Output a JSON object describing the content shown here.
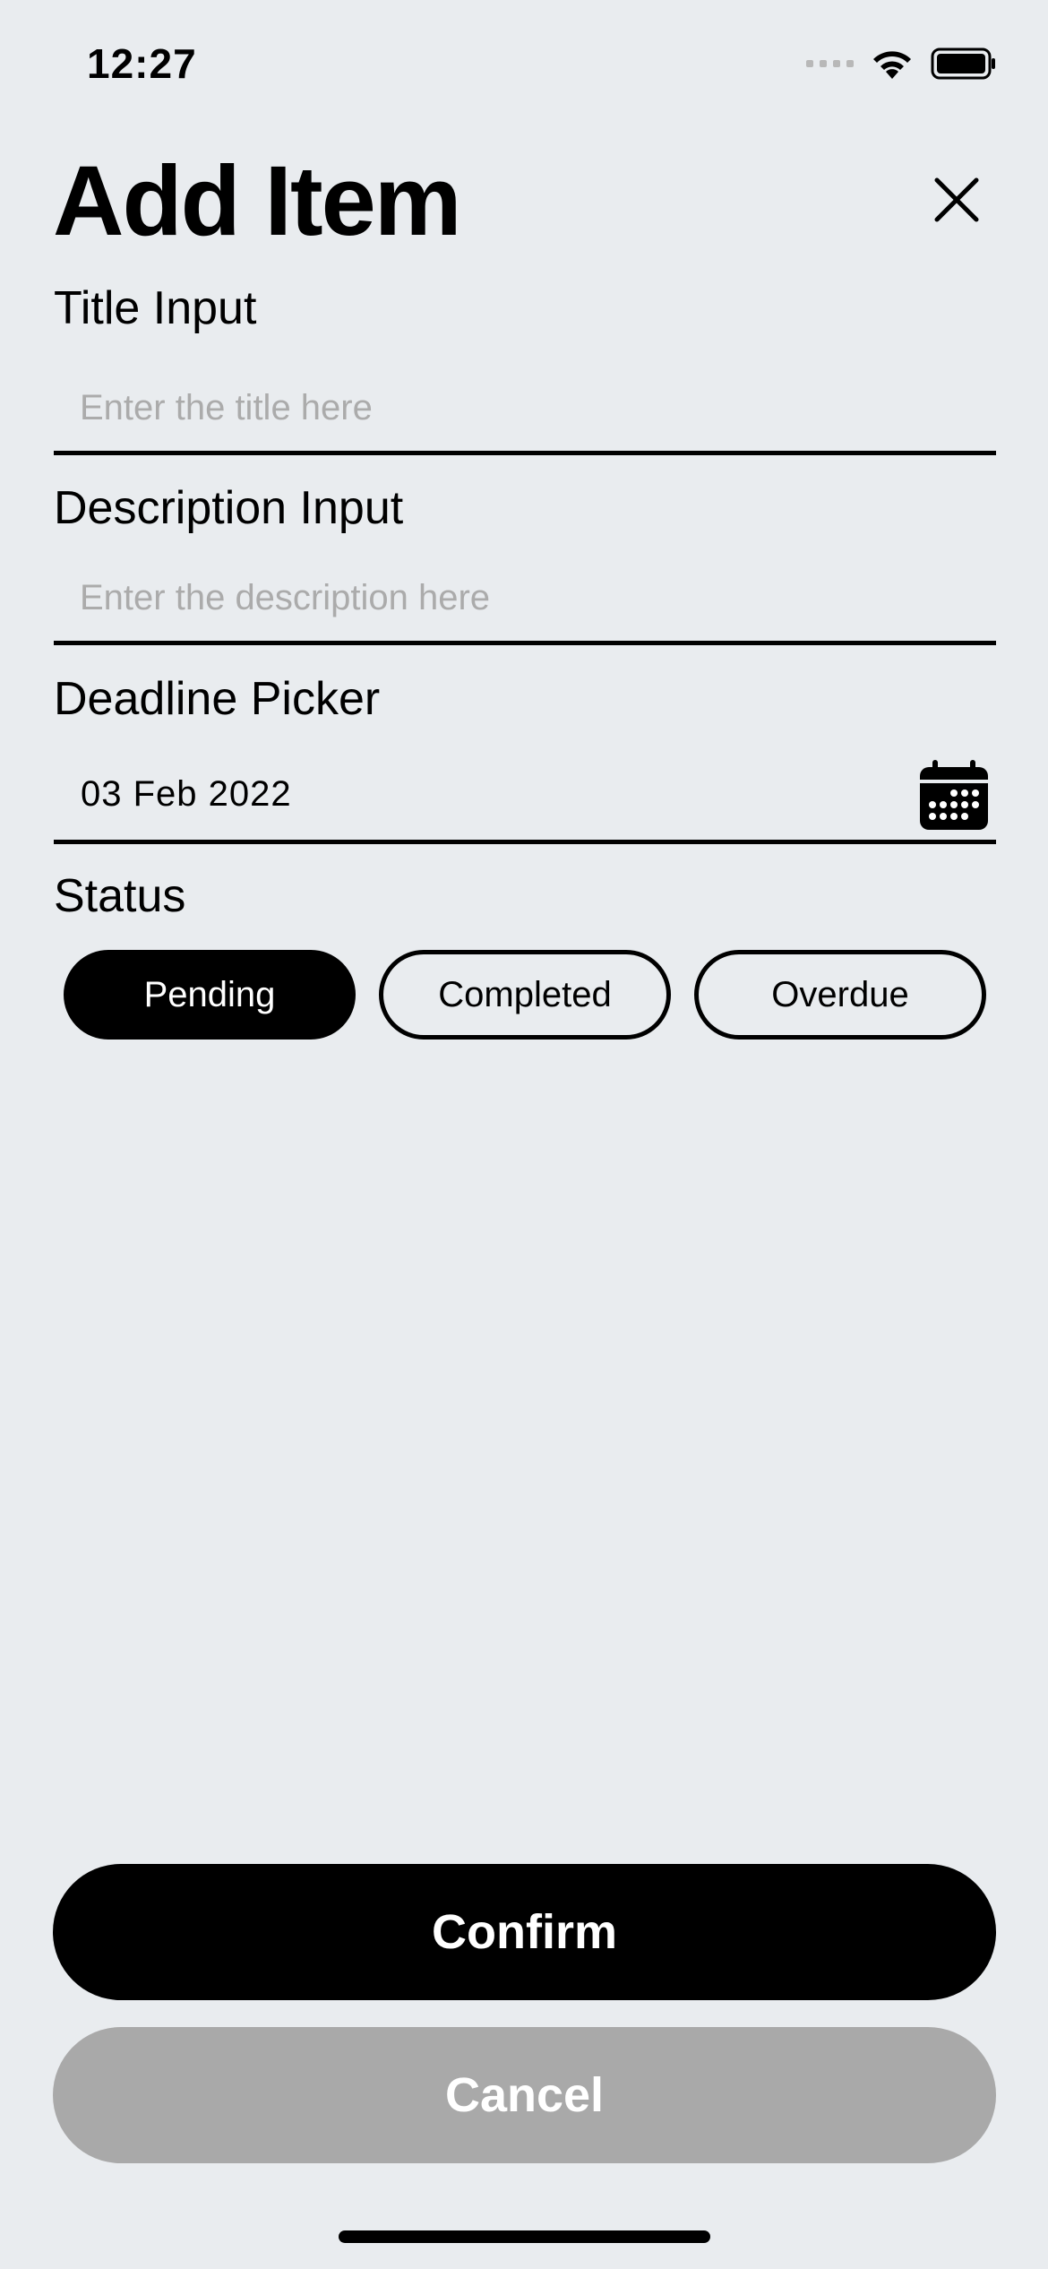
{
  "status_bar": {
    "time": "12:27",
    "icons": [
      "signal-icon",
      "wifi-icon",
      "battery-icon"
    ]
  },
  "header": {
    "title": "Add Item",
    "close_icon": "close-icon"
  },
  "form": {
    "title_field": {
      "label": "Title Input",
      "placeholder": "Enter the title here",
      "value": ""
    },
    "description_field": {
      "label": "Description Input",
      "placeholder": "Enter the description here",
      "value": ""
    },
    "deadline_field": {
      "label": "Deadline Picker",
      "value": "03 Feb 2022",
      "icon": "calendar-icon"
    },
    "status": {
      "label": "Status",
      "options": [
        "Pending",
        "Completed",
        "Overdue"
      ],
      "selected": "Pending"
    }
  },
  "actions": {
    "confirm_label": "Confirm",
    "cancel_label": "Cancel"
  },
  "colors": {
    "background": "#e9ecef",
    "primary": "#000000",
    "disabled": "#a9a9a9",
    "placeholder": "#ababab"
  }
}
